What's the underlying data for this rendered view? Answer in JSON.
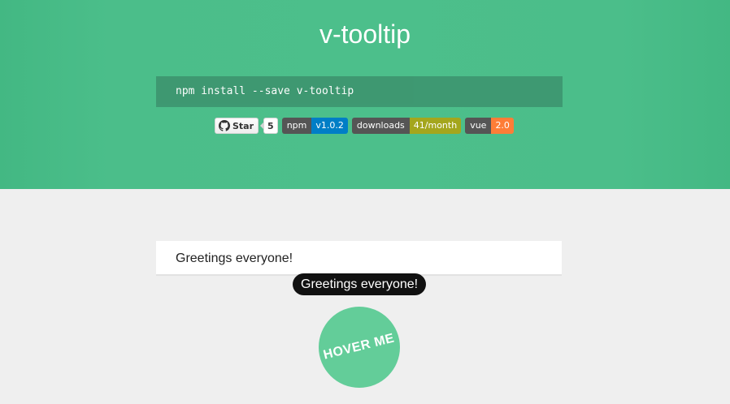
{
  "hero": {
    "title": "v-tooltip",
    "install_command": "npm install --save v-tooltip"
  },
  "badges": {
    "github_star_label": "Star",
    "github_star_icon": "github-icon",
    "github_star_count": "5",
    "shields": [
      {
        "label": "npm",
        "value": "v1.0.2",
        "color": "#007ec6"
      },
      {
        "label": "downloads",
        "value": "41/month",
        "color": "#a4a61d"
      },
      {
        "label": "vue",
        "value": "2.0",
        "color": "#fe7d37"
      }
    ]
  },
  "demo": {
    "input_value": "Greetings everyone!",
    "tooltip_text": "Greetings everyone!",
    "hover_button_label": "HOVER ME"
  },
  "colors": {
    "brand_green": "#4cbf8b",
    "install_bg": "#3e9871",
    "tooltip_bg": "#111111",
    "hover_circle": "#63cd99"
  }
}
